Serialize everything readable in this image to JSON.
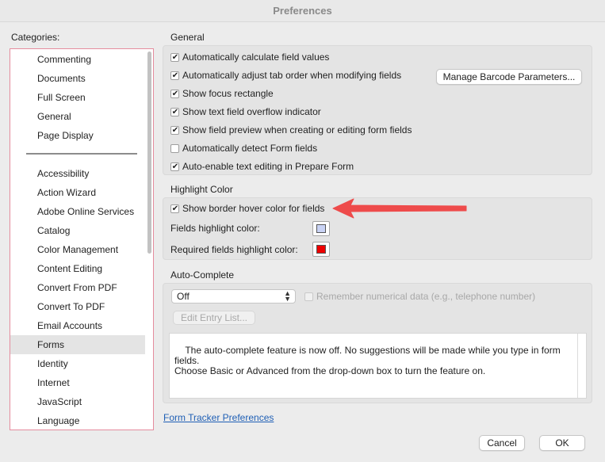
{
  "window": {
    "title": "Preferences"
  },
  "categories": {
    "label": "Categories:",
    "items_top": [
      "Commenting",
      "Documents",
      "Full Screen",
      "General",
      "Page Display"
    ],
    "items_bottom": [
      "Accessibility",
      "Action Wizard",
      "Adobe Online Services",
      "Catalog",
      "Color Management",
      "Content Editing",
      "Convert From PDF",
      "Convert To PDF",
      "Email Accounts",
      "Forms",
      "Identity",
      "Internet",
      "JavaScript",
      "Language"
    ],
    "selected": "Forms"
  },
  "general": {
    "title": "General",
    "options": [
      {
        "label": "Automatically calculate field values",
        "checked": true
      },
      {
        "label": "Automatically adjust tab order when modifying fields",
        "checked": true
      },
      {
        "label": "Show focus rectangle",
        "checked": true
      },
      {
        "label": "Show text field overflow indicator",
        "checked": true
      },
      {
        "label": "Show field preview when creating or editing form fields",
        "checked": true
      },
      {
        "label": "Automatically detect Form fields",
        "checked": false
      },
      {
        "label": "Auto-enable text editing in Prepare Form",
        "checked": true
      }
    ],
    "barcode_button": "Manage Barcode Parameters..."
  },
  "highlight": {
    "title": "Highlight Color",
    "hover_option": {
      "label": "Show border hover color for fields",
      "checked": true
    },
    "fields_label": "Fields highlight color:",
    "fields_color": "#c9d3f5",
    "required_label": "Required fields highlight color:",
    "required_color": "#ee0000"
  },
  "autocomplete": {
    "title": "Auto-Complete",
    "mode_value": "Off",
    "remember_label": "Remember numerical data (e.g., telephone number)",
    "remember_checked": false,
    "edit_button": "Edit Entry List...",
    "description": "The auto-complete feature is now off. No suggestions will be made while you type in form fields.\nChoose Basic or Advanced from the drop-down box to turn the feature on."
  },
  "footer": {
    "tracker_link": "Form Tracker Preferences",
    "cancel_label": "Cancel",
    "ok_label": "OK"
  },
  "annotation": {
    "arrow_color": "#ee4b4b"
  }
}
